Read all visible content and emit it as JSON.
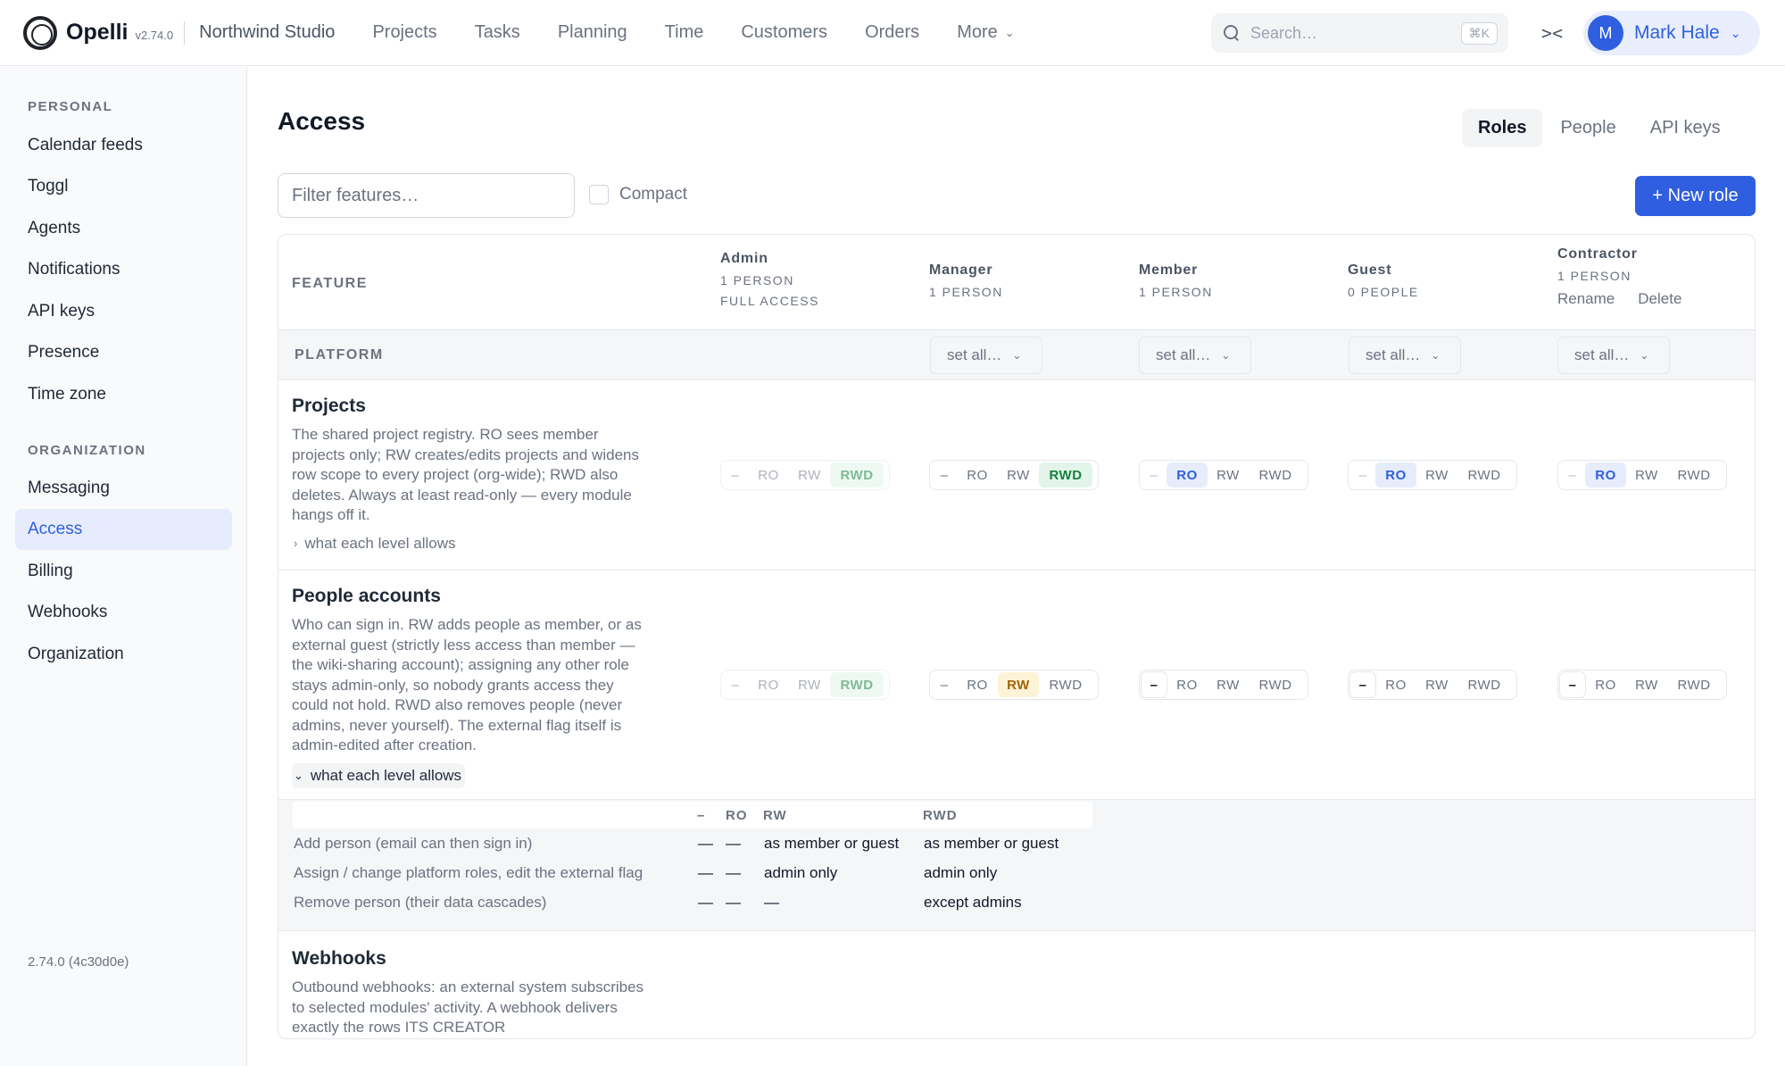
{
  "app": {
    "name": "Opelli",
    "version": "v2.74.0",
    "workspace": "Northwind Studio"
  },
  "nav": {
    "items": [
      "Projects",
      "Tasks",
      "Planning",
      "Time",
      "Customers",
      "Orders"
    ],
    "more_label": "More"
  },
  "search": {
    "placeholder": "Search…",
    "shortcut": "⌘K"
  },
  "collapse_glyph": "><",
  "user": {
    "initial": "M",
    "name": "Mark Hale"
  },
  "sidebar": {
    "personal_heading": "PERSONAL",
    "personal_items": [
      "Calendar feeds",
      "Toggl",
      "Agents",
      "Notifications",
      "API keys",
      "Presence",
      "Time zone"
    ],
    "org_heading": "ORGANIZATION",
    "org_items": [
      "Messaging",
      "Access",
      "Billing",
      "Webhooks",
      "Organization"
    ],
    "active_item": "Access",
    "footer_version": "2.74.0 (4c30d0e)"
  },
  "page": {
    "title": "Access",
    "tabs": [
      "Roles",
      "People",
      "API keys"
    ],
    "active_tab": "Roles",
    "filter_placeholder": "Filter features…",
    "compact_label": "Compact",
    "compact_checked": false,
    "new_role_label": "+ New role"
  },
  "table": {
    "feature_header": "FEATURE",
    "roles": [
      {
        "name": "Admin",
        "count": "1 PERSON",
        "note": "FULL ACCESS"
      },
      {
        "name": "Manager",
        "count": "1 PERSON"
      },
      {
        "name": "Member",
        "count": "1 PERSON"
      },
      {
        "name": "Guest",
        "count": "0 PEOPLE"
      },
      {
        "name": "Contractor",
        "count": "1 PERSON",
        "links": [
          "Rename",
          "Delete"
        ]
      }
    ],
    "section_label": "PLATFORM",
    "set_all_label": "set all…",
    "level_labels": [
      "–",
      "RO",
      "RW",
      "RWD"
    ],
    "features": [
      {
        "title": "Projects",
        "description": "The shared project registry. RO sees member projects only; RW creates/edits projects and widens row scope to every project (org-wide); RWD also deletes. Always at least read-only — every module hangs off it.",
        "levels_link": "what each level allows",
        "expanded": false,
        "levels": [
          "RWD",
          "RWD",
          "RO",
          "RO",
          "RO"
        ]
      },
      {
        "title": "People accounts",
        "description": "Who can sign in. RW adds people as member, or as external guest (strictly less access than member — the wiki-sharing account); assigning any other role stays admin-only, so nobody grants access they could not hold. RWD also removes people (never admins, never yourself). The external flag itself is admin-edited after creation.",
        "levels_link": "what each level allows",
        "expanded": true,
        "levels": [
          "RWD",
          "RW",
          "–",
          "–",
          "–"
        ],
        "level_detail": {
          "headers": [
            "–",
            "RO",
            "RW",
            "RWD"
          ],
          "rows": [
            {
              "label": "Add person (email can then sign in)",
              "values": [
                "—",
                "—",
                "as member or guest",
                "as member or guest"
              ]
            },
            {
              "label": "Assign / change platform roles, edit the external flag",
              "values": [
                "—",
                "—",
                "admin only",
                "admin only"
              ]
            },
            {
              "label": "Remove person (their data cascades)",
              "values": [
                "—",
                "—",
                "—",
                "except admins"
              ]
            }
          ]
        }
      },
      {
        "title": "Webhooks",
        "description": "Outbound webhooks: an external system subscribes to selected modules' activity. A webhook delivers exactly the rows ITS CREATOR"
      }
    ]
  }
}
